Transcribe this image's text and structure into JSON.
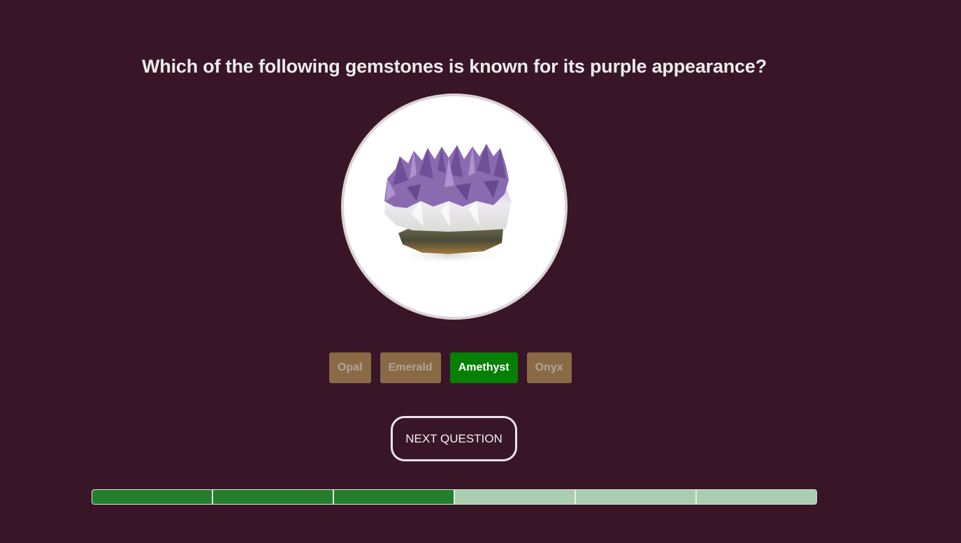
{
  "question": {
    "text": "Which of the following gemstones is known for its purple appearance?"
  },
  "image": {
    "subject": "amethyst-cluster"
  },
  "options": [
    {
      "label": "Opal",
      "state": "disabled"
    },
    {
      "label": "Emerald",
      "state": "disabled"
    },
    {
      "label": "Amethyst",
      "state": "correct"
    },
    {
      "label": "Onyx",
      "state": "disabled"
    }
  ],
  "next_button": {
    "label": "NEXT QUESTION"
  },
  "progress": {
    "total": 6,
    "completed": 3
  },
  "colors": {
    "background": "#381628",
    "correct": "#058005",
    "disabled": "#8a6a44",
    "progress_done": "#237e2e",
    "progress_todo": "#a9ceb0"
  }
}
